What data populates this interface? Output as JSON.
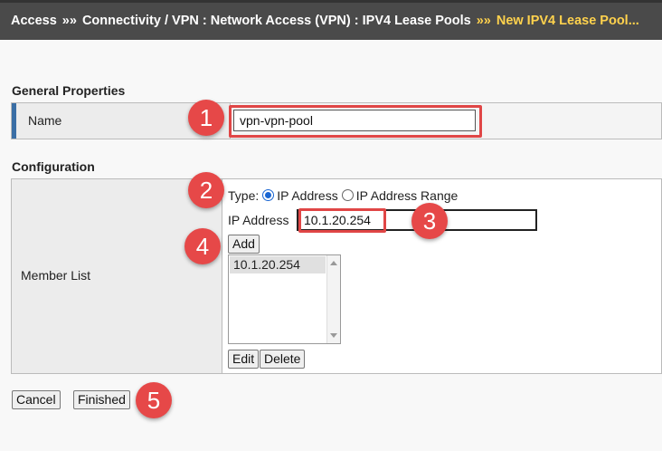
{
  "breadcrumb": {
    "items": [
      "Access",
      "Connectivity / VPN : Network Access (VPN) : IPV4 Lease Pools"
    ],
    "current": "New IPV4 Lease Pool...",
    "separator": "»»"
  },
  "general_properties": {
    "title": "General Properties",
    "name_label": "Name",
    "name_value": "vpn-vpn-pool"
  },
  "configuration": {
    "title": "Configuration",
    "member_list_label": "Member List",
    "type_label": "Type:",
    "type_options": [
      "IP Address",
      "IP Address Range"
    ],
    "type_selected": "IP Address",
    "ip_address_label": "IP Address",
    "ip_address_value": "10.1.20.254",
    "add_label": "Add",
    "members": [
      "10.1.20.254"
    ],
    "edit_label": "Edit",
    "delete_label": "Delete"
  },
  "footer": {
    "cancel_label": "Cancel",
    "finished_label": "Finished"
  },
  "annotations": [
    "1",
    "2",
    "3",
    "4",
    "5"
  ],
  "colors": {
    "topbar": "#4a4a4a",
    "current_crumb": "#ffd24d",
    "badge": "#e64848",
    "accent": "#3a6ea5"
  }
}
